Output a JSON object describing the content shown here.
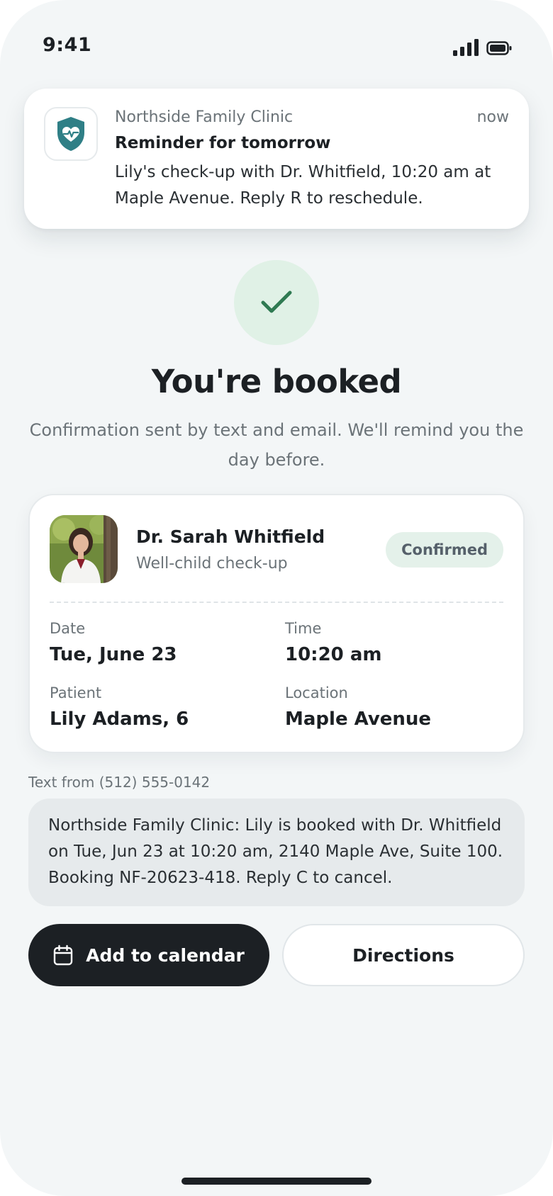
{
  "status_bar": {
    "time": "9:41"
  },
  "notification": {
    "app_name": "Northside Family Clinic",
    "time": "now",
    "title": "Reminder for tomorrow",
    "body": "Lily's check-up with Dr. Whitfield, 10:20 am at Maple Avenue. Reply R to reschedule."
  },
  "confirmation": {
    "title": "You're booked",
    "subtitle": "Confirmation sent by text and email. We'll remind you the day before."
  },
  "appointment": {
    "doctor_name": "Dr. Sarah Whitfield",
    "visit_type": "Well-child check-up",
    "status": "Confirmed",
    "date_label": "Date",
    "date_value": "Tue, June 23",
    "time_label": "Time",
    "time_value": "10:20 am",
    "patient_label": "Patient",
    "patient_value": "Lily Adams, 6",
    "location_label": "Location",
    "location_value": "Maple Avenue"
  },
  "sms": {
    "from": "Text from (512) 555-0142",
    "body": "Northside Family Clinic: Lily is booked with Dr. Whitfield on Tue, Jun 23 at 10:20 am, 2140 Maple Ave, Suite 100. Booking NF-20623-418. Reply C to cancel."
  },
  "actions": {
    "add_calendar_label": "Add to calendar",
    "directions_label": "Directions"
  },
  "colors": {
    "accent_dark": "#1c2024",
    "success_bg": "#e0f1e6",
    "success_check": "#2f7a52",
    "clinic_icon": "#2f7f86"
  },
  "icons": {
    "clinic": "heart-shield-icon",
    "success": "checkmark-icon",
    "calendar": "calendar-icon"
  }
}
